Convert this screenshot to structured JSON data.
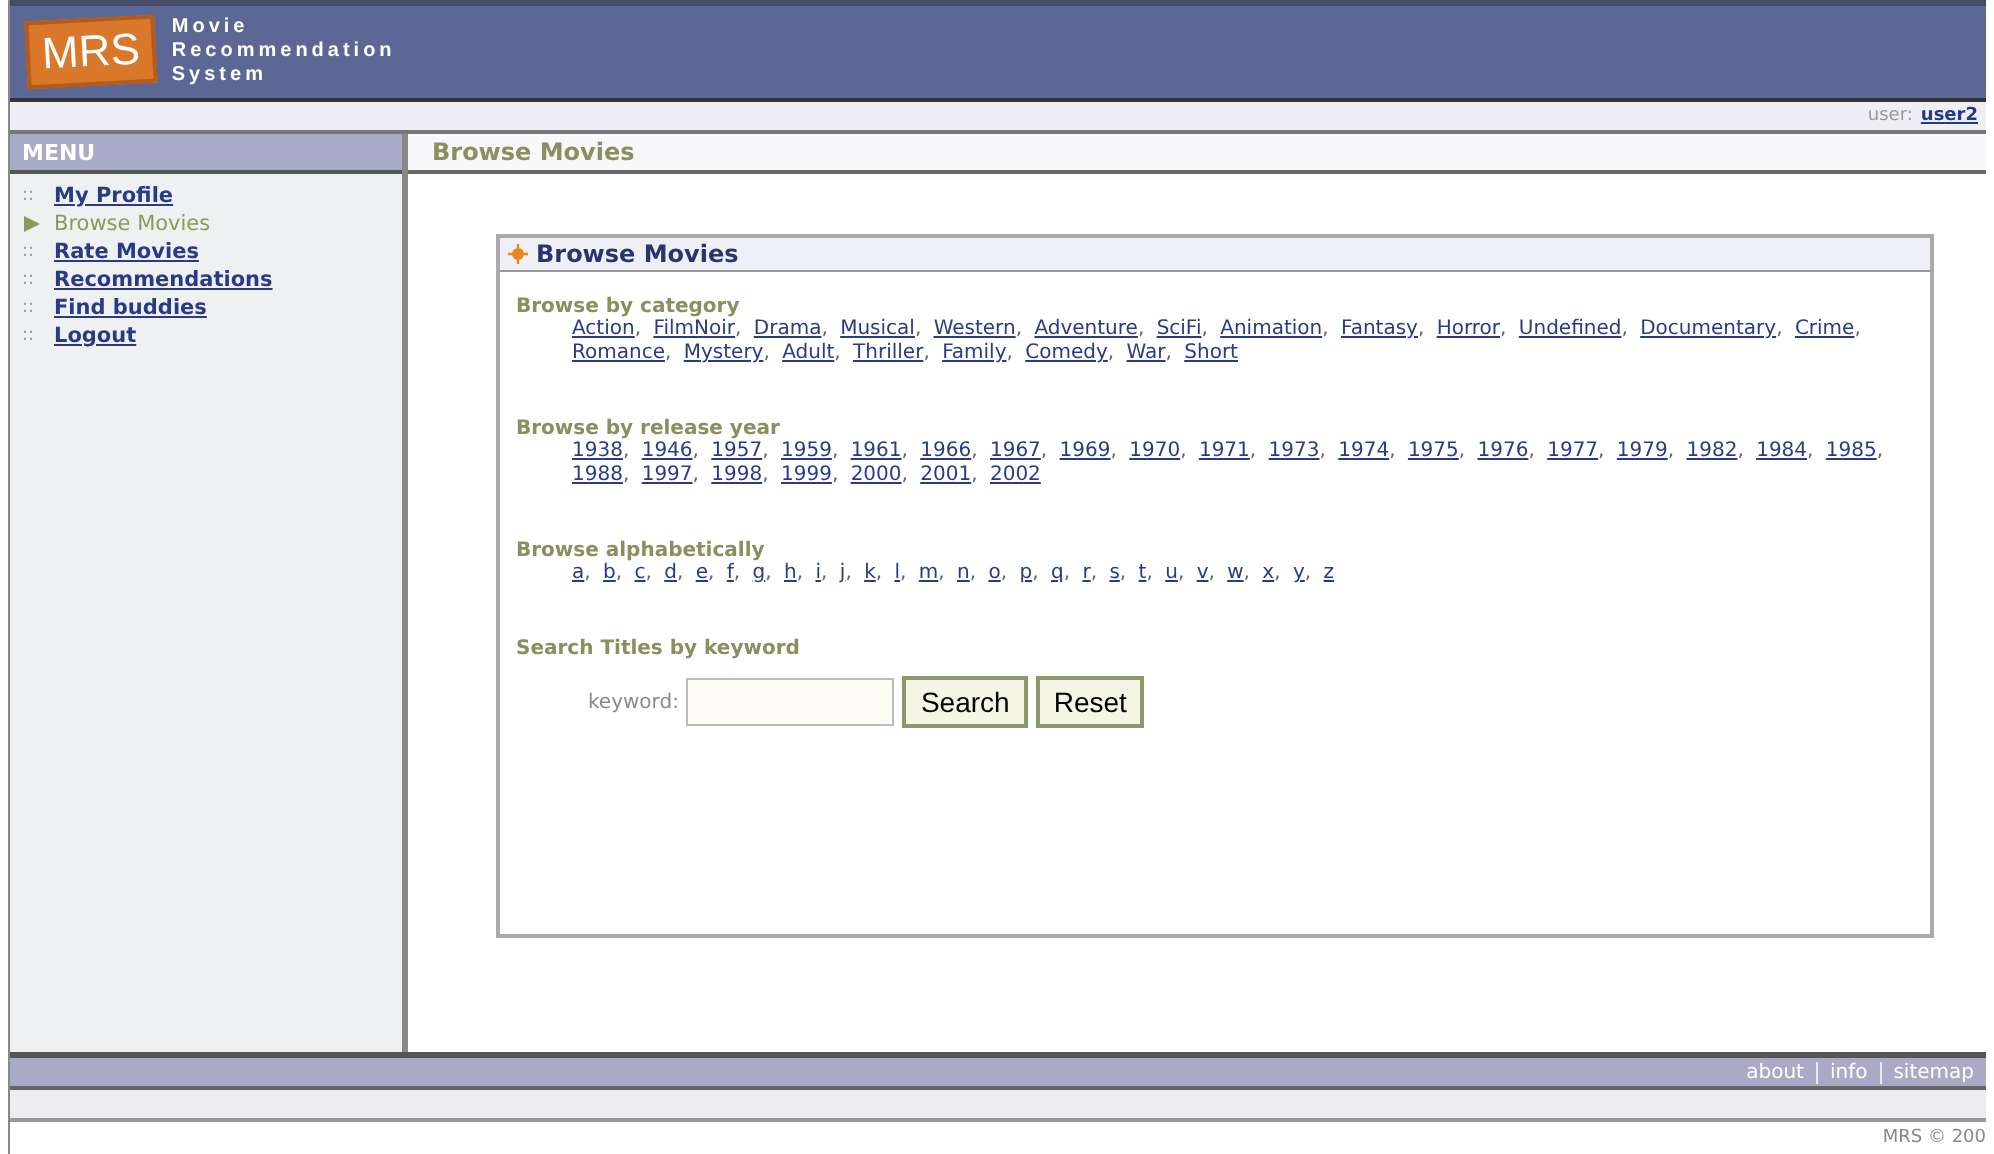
{
  "header": {
    "logo": "MRS",
    "title_lines": [
      "Movie",
      "Recommendation",
      "System"
    ]
  },
  "user_bar": {
    "label": "user:",
    "user": "user2"
  },
  "menu": {
    "title": "MENU",
    "bullet": "::",
    "items": [
      {
        "label": "My Profile",
        "selected": false
      },
      {
        "label": "Browse Movies",
        "selected": true
      },
      {
        "label": "Rate Movies",
        "selected": false
      },
      {
        "label": "Recommendations",
        "selected": false
      },
      {
        "label": "Find buddies",
        "selected": false
      },
      {
        "label": "Logout",
        "selected": false
      }
    ]
  },
  "page_title": "Browse Movies",
  "panel": {
    "title": "Browse Movies",
    "separator": ",",
    "sections": [
      {
        "heading": "Browse by category",
        "links": [
          "Action",
          "FilmNoir",
          "Drama",
          "Musical",
          "Western",
          "Adventure",
          "SciFi",
          "Animation",
          "Fantasy",
          "Horror",
          "Undefined",
          "Documentary",
          "Crime",
          "Romance",
          "Mystery",
          "Adult",
          "Thriller",
          "Family",
          "Comedy",
          "War",
          "Short"
        ]
      },
      {
        "heading": "Browse by release year",
        "links": [
          "1938",
          "1946",
          "1957",
          "1959",
          "1961",
          "1966",
          "1967",
          "1969",
          "1970",
          "1971",
          "1973",
          "1974",
          "1975",
          "1976",
          "1977",
          "1979",
          "1982",
          "1984",
          "1985",
          "1988",
          "1997",
          "1998",
          "1999",
          "2000",
          "2001",
          "2002"
        ]
      },
      {
        "heading": "Browse alphabetically",
        "links": [
          "a",
          "b",
          "c",
          "d",
          "e",
          "f",
          "g",
          "h",
          "i",
          "j",
          "k",
          "l",
          "m",
          "n",
          "o",
          "p",
          "q",
          "r",
          "s",
          "t",
          "u",
          "v",
          "w",
          "x",
          "y",
          "z"
        ]
      }
    ],
    "search": {
      "heading": "Search Titles by keyword",
      "label": "keyword:",
      "buttons": [
        "Search",
        "Reset"
      ]
    }
  },
  "footer": {
    "links": [
      "about",
      "info",
      "sitemap"
    ],
    "copyright": "MRS © 200"
  }
}
